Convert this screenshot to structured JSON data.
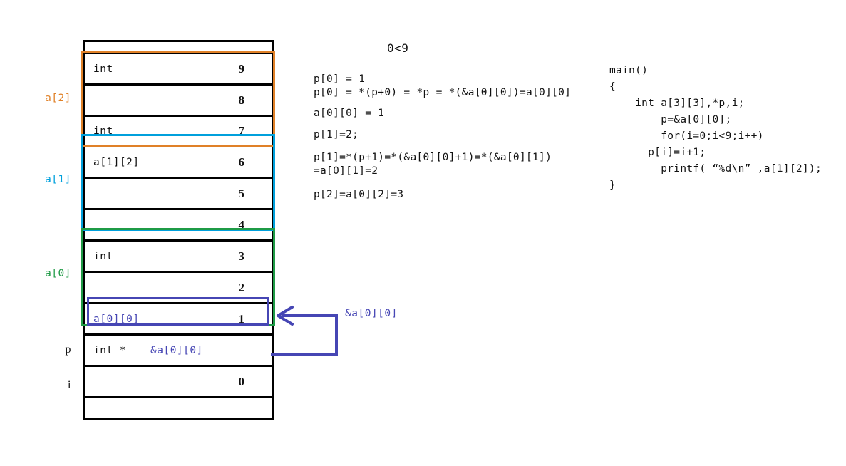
{
  "diagram": {
    "title_condition": "0<9",
    "memory_rows": [
      {
        "type": "",
        "type2": "",
        "value": "",
        "index": 0
      },
      {
        "type": "int",
        "type2": "",
        "value": "9",
        "index": 1
      },
      {
        "type": "",
        "type2": "",
        "value": "8",
        "index": 2
      },
      {
        "type": "int",
        "type2": "",
        "value": "7",
        "index": 3
      },
      {
        "type": "a[1][2]",
        "type2": "",
        "value": "6",
        "index": 4
      },
      {
        "type": "",
        "type2": "",
        "value": "5",
        "index": 5
      },
      {
        "type": "",
        "type2": "",
        "value": "4",
        "index": 6
      },
      {
        "type": "int",
        "type2": "",
        "value": "3",
        "index": 7
      },
      {
        "type": "",
        "type2": "",
        "value": "2",
        "index": 8
      },
      {
        "type": "a[0][0]",
        "type2": "",
        "value": "1",
        "index": 9
      },
      {
        "type": "int *",
        "type2": "&a[0][0]",
        "value": "",
        "index": 10
      },
      {
        "type": "",
        "type2": "",
        "value": "0",
        "index": 11
      },
      {
        "type": "",
        "type2": "",
        "value": "",
        "index": 12
      }
    ],
    "row_labels": {
      "a2": "a[2]",
      "a1": "a[1]",
      "a0": "a[0]",
      "p": "p",
      "i": "i"
    },
    "arrow_label": "&a[0][0]",
    "colors": {
      "a2_group": "#e08128",
      "a1_group": "#00a0dc",
      "a0_group": "#1f9b46",
      "highlight": "#4646b4",
      "table_border": "#000000"
    }
  },
  "explanation": {
    "lines": [
      "p[0] = 1",
      "p[0] = *(p+0) = *p = *(&a[0][0])=a[0][0]",
      " a[0][0] = 1",
      " p[1]=2;",
      "p[1]=*(p+1)=*(&a[0][0]+1)=*(&a[0][1])",
      "=a[0][1]=2",
      "p[2]=a[0][2]=3"
    ]
  },
  "code": {
    "lines": [
      "main()",
      "{",
      "    int a[3][3],*p,i;",
      "        p=&a[0][0];",
      "        for(i=0;i<9;i++)",
      "      p[i]=i+1;",
      "        printf( “%d\\n” ,a[1][2]);",
      "}"
    ]
  }
}
